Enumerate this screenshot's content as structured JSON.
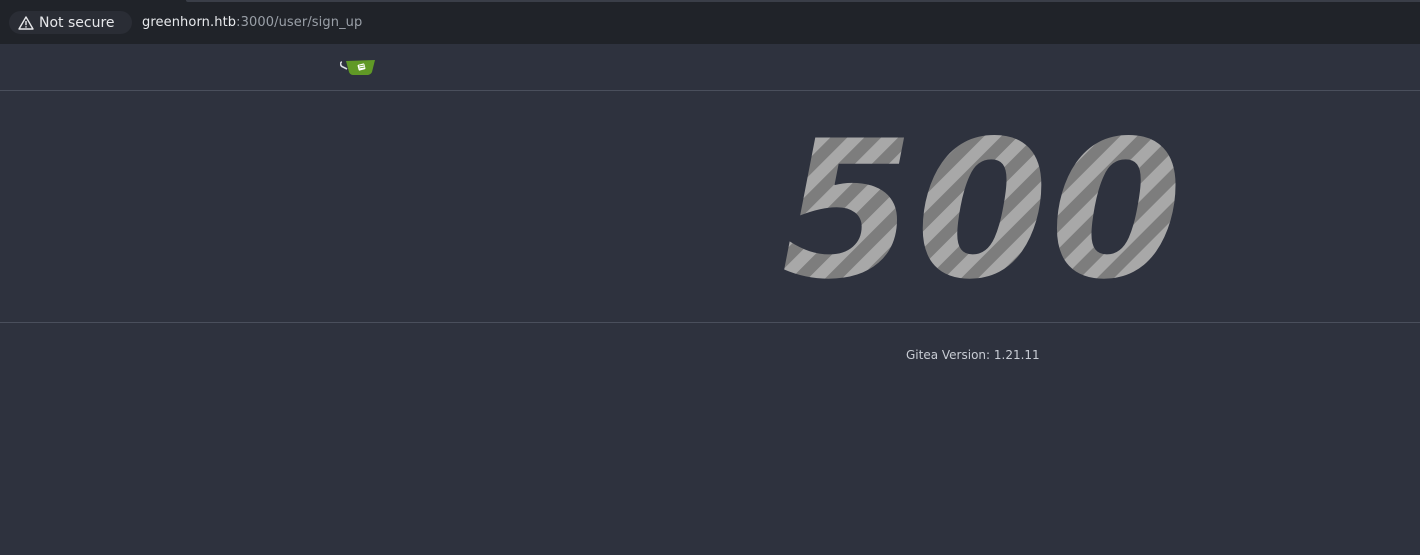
{
  "browser": {
    "security_label": "Not secure",
    "url_host": "greenhorn.htb",
    "url_path": ":3000/user/sign_up"
  },
  "navbar": {
    "logo_icon": "gitea-teacup-icon"
  },
  "error": {
    "code": "500"
  },
  "footer": {
    "version_text": "Gitea Version: 1.21.11"
  },
  "colors": {
    "background": "#2e323e",
    "browser_bar": "#202329",
    "logo_green": "#609926",
    "stripe_light": "#a8a8a8",
    "stripe_dark": "#7d7d7d"
  }
}
